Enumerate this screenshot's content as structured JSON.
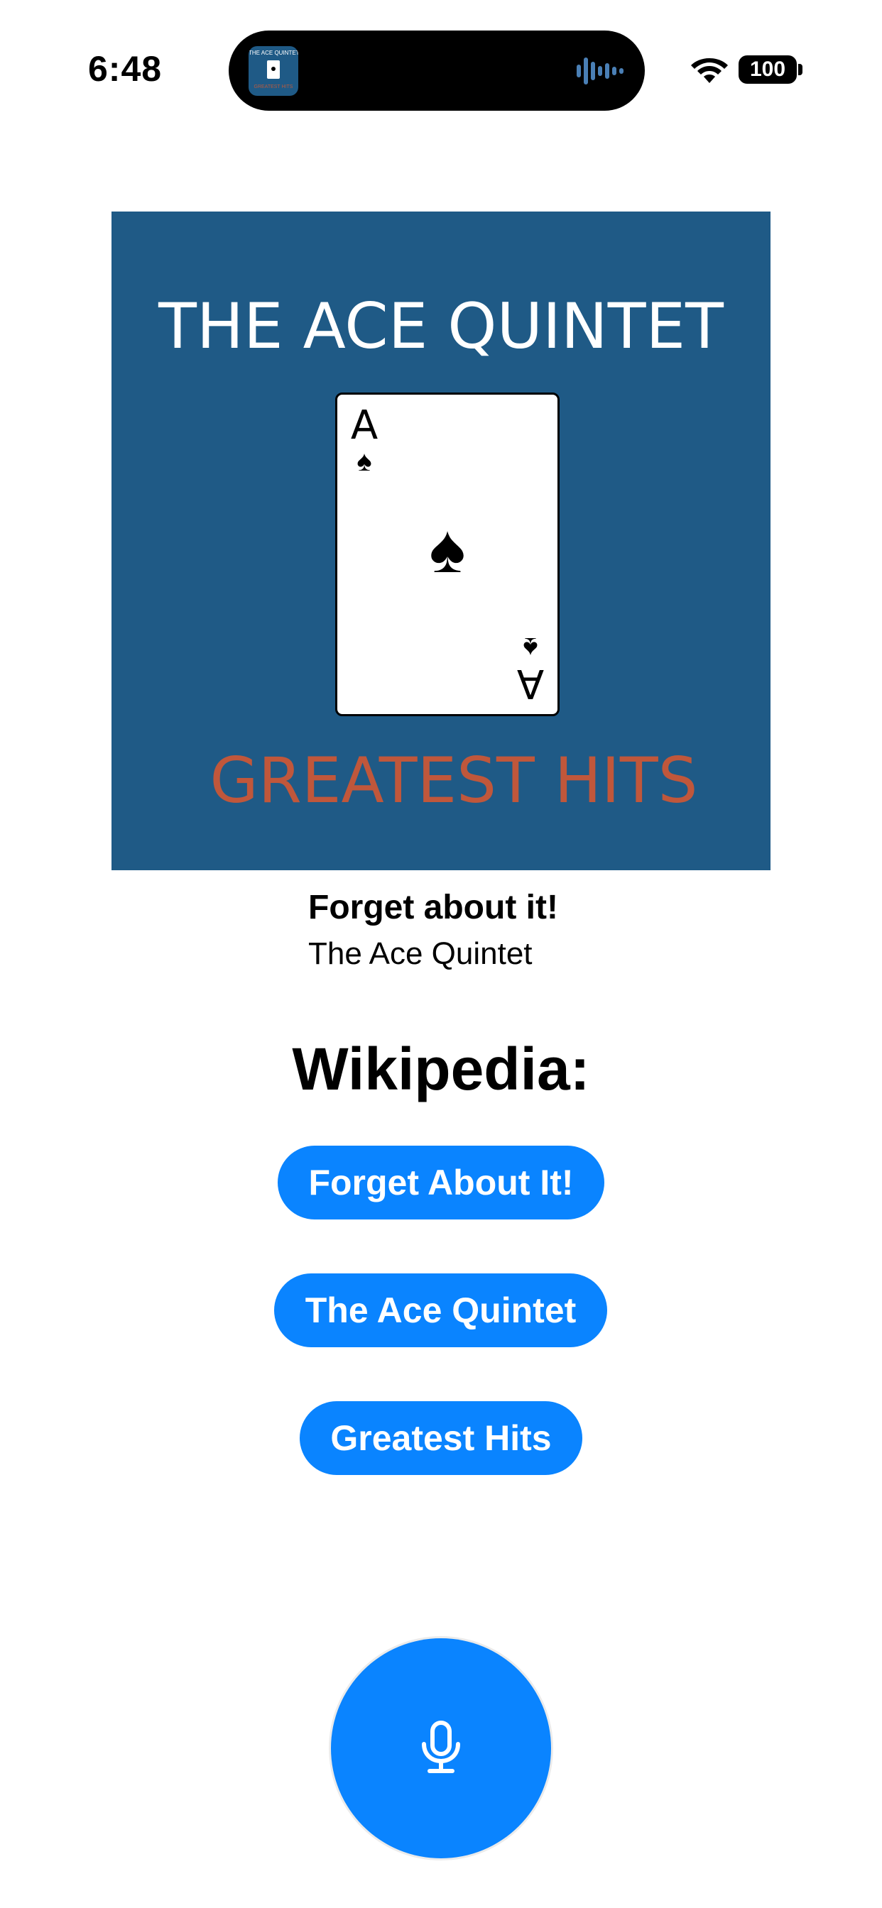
{
  "status_bar": {
    "time": "6:48",
    "battery": "100"
  },
  "island": {
    "thumb_title": "THE ACE QUINTET",
    "thumb_subtitle": "GREATEST HITS"
  },
  "album_art": {
    "band_name": "THE ACE QUINTET",
    "album_name": "GREATEST HITS",
    "card_rank": "A",
    "card_suit": "♠",
    "background_color": "#1f5a86",
    "subtitle_color": "#c0573b"
  },
  "now_playing": {
    "title": "Forget about it!",
    "artist": "The Ace Quintet"
  },
  "wikipedia": {
    "heading": "Wikipedia:",
    "buttons": [
      {
        "label": "Forget About It!"
      },
      {
        "label": "The Ace Quintet"
      },
      {
        "label": "Greatest Hits"
      }
    ]
  },
  "mic": {
    "icon": "microphone-icon"
  },
  "colors": {
    "accent": "#0a84ff"
  }
}
